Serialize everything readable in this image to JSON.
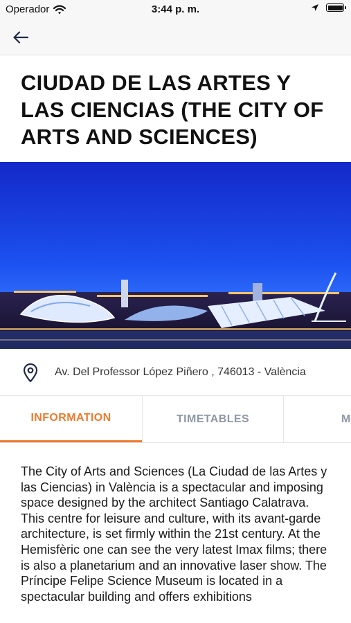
{
  "status_bar": {
    "carrier": "Operador",
    "time": "3:44 p. m."
  },
  "nav": {
    "back_icon": "arrow-left-icon"
  },
  "page": {
    "title": "CIUDAD DE LAS ARTES Y LAS CIENCIAS (THE CITY OF ARTS AND SCIENCES)"
  },
  "location": {
    "icon": "map-pin-icon",
    "address": "Av. Del Professor López Piñero , 746013 - València"
  },
  "tabs": [
    {
      "label": "INFORMATION",
      "active": true
    },
    {
      "label": "TIMETABLES",
      "active": false
    },
    {
      "label": "M",
      "active": false
    }
  ],
  "colors": {
    "accent": "#ee7a2c",
    "tab_inactive": "#8d97a6",
    "sky": "#1a3fe0"
  },
  "description": "The City of Arts and Sciences (La Ciudad de las Artes y las Ciencias) in València is a spectacular and imposing space designed by the architect Santiago Calatrava. This centre for leisure and culture, with its avant-garde architecture, is set firmly within the 21st century. At the Hemisfèric one can see the very latest Imax films; there is also a planetarium and an innovative laser show. The Príncipe Felipe Science Museum is located in a spectacular building and offers exhibitions"
}
